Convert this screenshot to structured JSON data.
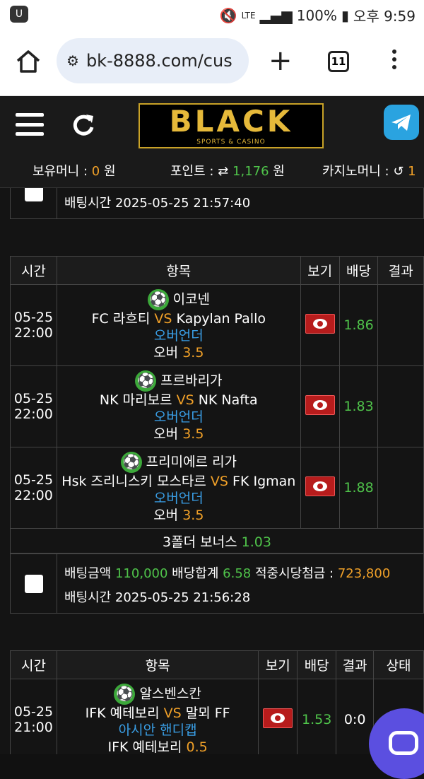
{
  "status": {
    "app_icon": "U",
    "battery": "100%",
    "time": "오후 9:59",
    "network": "LTE"
  },
  "browser": {
    "url": "bk-8888.com/cus",
    "tab_count": "11"
  },
  "header": {
    "logo": "BLACK",
    "logo_sub": "SPORTS & CASINO"
  },
  "balances": {
    "money_label": "보유머니 :",
    "money_value": "0",
    "money_unit": "원",
    "point_label": "포인트 :",
    "point_value": "1,176",
    "point_unit": "원",
    "casino_label": "카지노머니 :",
    "casino_value": "1"
  },
  "top_slip": {
    "time_label": "배팅시간",
    "time_value": "2025-05-25 21:57:40"
  },
  "table1": {
    "headers": [
      "시간",
      "항목",
      "보기",
      "배당",
      "결과"
    ],
    "rows": [
      {
        "date": "05-25",
        "time": "22:00",
        "league": "이코넨",
        "home": "FC 라흐티",
        "vs": "VS",
        "away": "Kapylan Pallo",
        "market": "오버언더",
        "pick": "오버",
        "line": "3.5",
        "odds": "1.86"
      },
      {
        "date": "05-25",
        "time": "22:00",
        "league": "프르바리가",
        "home": "NK 마리보르",
        "vs": "VS",
        "away": "NK Nafta",
        "market": "오버언더",
        "pick": "오버",
        "line": "3.5",
        "odds": "1.83"
      },
      {
        "date": "05-25",
        "time": "22:00",
        "league": "프리미에르 리가",
        "home": "Hsk 즈리니스키 모스타르",
        "vs": "VS",
        "away": "FK Igman",
        "market": "오버언더",
        "pick": "오버",
        "line": "3.5",
        "odds": "1.88"
      }
    ],
    "bonus_label": "3폴더 보너스",
    "bonus_value": "1.03"
  },
  "slip2": {
    "amount_label": "배팅금액",
    "amount_value": "110,000",
    "total_label": "배당합계",
    "total_value": "6.58",
    "win_label": "적중시당첨금 :",
    "win_value": "723,800",
    "time_label": "배팅시간",
    "time_value": "2025-05-25 21:56:28"
  },
  "table2": {
    "headers": [
      "시간",
      "항목",
      "보기",
      "배당",
      "결과",
      "상태"
    ],
    "row": {
      "date": "05-25",
      "time": "21:00",
      "league": "알스벤스칸",
      "home": "IFK 예테보리",
      "vs": "VS",
      "away": "말뫼 FF",
      "market": "아시안 핸디캡",
      "pick": "IFK 예테보리",
      "line": "0.5",
      "odds": "1.53",
      "result": "0:0"
    }
  }
}
